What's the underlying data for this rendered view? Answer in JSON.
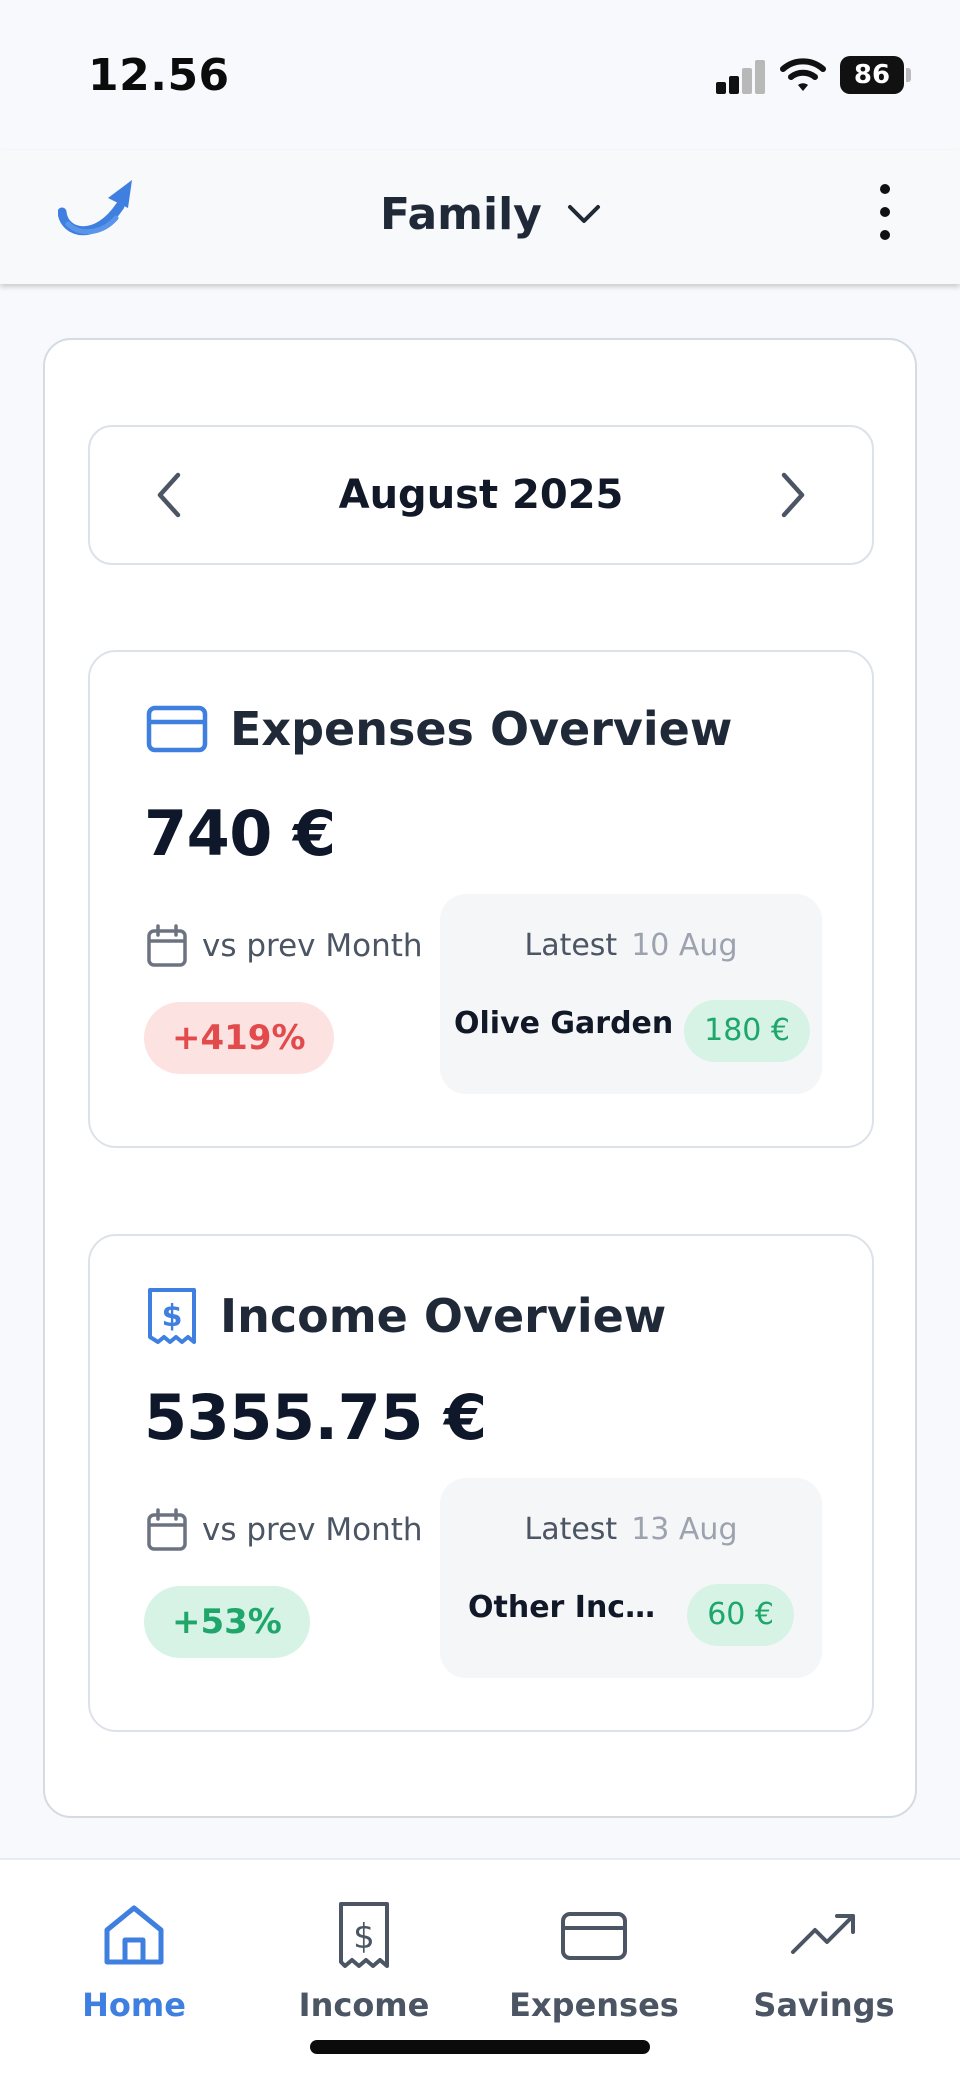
{
  "status_bar": {
    "time": "12.56",
    "battery": "86"
  },
  "header": {
    "team": "Family"
  },
  "month_nav": {
    "label": "August 2025"
  },
  "expenses": {
    "title": "Expenses Overview",
    "amount": "740 €",
    "vs_label": "vs prev Month",
    "change": "+419%",
    "latest_label": "Latest",
    "latest_date": "10 Aug",
    "latest_name": "Olive Garden",
    "latest_amount": "180 €"
  },
  "income": {
    "title": "Income Overview",
    "amount": "5355.75 €",
    "vs_label": "vs prev Month",
    "change": "+53%",
    "latest_label": "Latest",
    "latest_date": "13 Aug",
    "latest_name": "Other Inco...",
    "latest_amount": "60 €"
  },
  "bottom_nav": {
    "items": [
      {
        "label": "Home",
        "icon": "home-icon",
        "active": true
      },
      {
        "label": "Income",
        "icon": "receipt-dollar-icon",
        "active": false
      },
      {
        "label": "Expenses",
        "icon": "credit-card-icon",
        "active": false
      },
      {
        "label": "Savings",
        "icon": "trending-up-icon",
        "active": false
      }
    ]
  },
  "colors": {
    "accent": "#3f7fe0",
    "negative": "#e24b4b",
    "positive": "#1ea66b",
    "negative_bg": "#fde2e2",
    "positive_bg": "#d6f3e6"
  }
}
